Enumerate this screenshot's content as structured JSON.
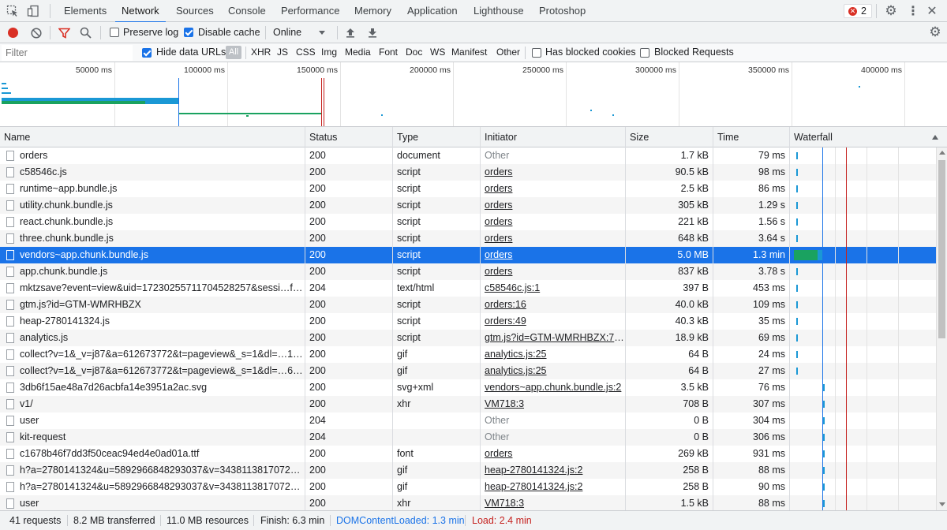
{
  "tabs": [
    "Elements",
    "Network",
    "Sources",
    "Console",
    "Performance",
    "Memory",
    "Application",
    "Lighthouse",
    "Protoshop"
  ],
  "error_count": "2",
  "toolbar": {
    "preserve_log": "Preserve log",
    "preserve_log_checked": false,
    "disable_cache": "Disable cache",
    "disable_cache_checked": true,
    "throttling": "Online"
  },
  "filterbar": {
    "placeholder": "Filter",
    "hide_data_urls": "Hide data URLs",
    "all": "All",
    "types": [
      "XHR",
      "JS",
      "CSS",
      "Img",
      "Media",
      "Font",
      "Doc",
      "WS",
      "Manifest",
      "Other"
    ],
    "has_blocked_cookies": "Has blocked cookies",
    "blocked_requests": "Blocked Requests"
  },
  "overview": {
    "ticks": [
      "50000 ms",
      "100000 ms",
      "150000 ms",
      "200000 ms",
      "250000 ms",
      "300000 ms",
      "350000 ms",
      "400000 ms"
    ]
  },
  "columns": [
    "Name",
    "Status",
    "Type",
    "Initiator",
    "Size",
    "Time",
    "Waterfall"
  ],
  "rows": [
    {
      "name": "orders",
      "status": "200",
      "type": "document",
      "initiator": "Other",
      "initiator_link": false,
      "size": "1.7 kB",
      "time": "79 ms",
      "wf": 0.02
    },
    {
      "name": "c58546c.js",
      "status": "200",
      "type": "script",
      "initiator": "orders",
      "initiator_link": true,
      "size": "90.5 kB",
      "time": "98 ms",
      "wf": 0.02
    },
    {
      "name": "runtime~app.bundle.js",
      "status": "200",
      "type": "script",
      "initiator": "orders",
      "initiator_link": true,
      "size": "2.5 kB",
      "time": "86 ms",
      "wf": 0.02
    },
    {
      "name": "utility.chunk.bundle.js",
      "status": "200",
      "type": "script",
      "initiator": "orders",
      "initiator_link": true,
      "size": "305 kB",
      "time": "1.29 s",
      "wf": 0.02
    },
    {
      "name": "react.chunk.bundle.js",
      "status": "200",
      "type": "script",
      "initiator": "orders",
      "initiator_link": true,
      "size": "221 kB",
      "time": "1.56 s",
      "wf": 0.02
    },
    {
      "name": "three.chunk.bundle.js",
      "status": "200",
      "type": "script",
      "initiator": "orders",
      "initiator_link": true,
      "size": "648 kB",
      "time": "3.64 s",
      "wf": 0.02
    },
    {
      "name": "vendors~app.chunk.bundle.js",
      "status": "200",
      "type": "script",
      "initiator": "orders",
      "initiator_link": true,
      "size": "5.0 MB",
      "time": "1.3 min",
      "selected": true,
      "wf": 0.2
    },
    {
      "name": "app.chunk.bundle.js",
      "status": "200",
      "type": "script",
      "initiator": "orders",
      "initiator_link": true,
      "size": "837 kB",
      "time": "3.78 s",
      "wf": 0.02
    },
    {
      "name": "mktzsave?event=view&uid=17230255711704528257&sessi…ferer…",
      "status": "204",
      "type": "text/html",
      "initiator": "c58546c.js:1",
      "initiator_link": true,
      "size": "397 B",
      "time": "453 ms",
      "wf": 0.02
    },
    {
      "name": "gtm.js?id=GTM-WMRHBZX",
      "status": "200",
      "type": "script",
      "initiator": "orders:16",
      "initiator_link": true,
      "size": "40.0 kB",
      "time": "109 ms",
      "wf": 0.02
    },
    {
      "name": "heap-2780141324.js",
      "status": "200",
      "type": "script",
      "initiator": "orders:49",
      "initiator_link": true,
      "size": "40.3 kB",
      "time": "35 ms",
      "wf": 0.02
    },
    {
      "name": "analytics.js",
      "status": "200",
      "type": "script",
      "initiator": "gtm.js?id=GTM-WMRHBZX:703",
      "initiator_link": true,
      "size": "18.9 kB",
      "time": "69 ms",
      "wf": 0.02
    },
    {
      "name": "collect?v=1&_v=j87&a=612673772&t=pageview&_s=1&dl=…16118…",
      "status": "200",
      "type": "gif",
      "initiator": "analytics.js:25",
      "initiator_link": true,
      "size": "64 B",
      "time": "24 ms",
      "wf": 0.02
    },
    {
      "name": "collect?v=1&_v=j87&a=612673772&t=pageview&_s=1&dl=…61186…",
      "status": "200",
      "type": "gif",
      "initiator": "analytics.js:25",
      "initiator_link": true,
      "size": "64 B",
      "time": "27 ms",
      "wf": 0.02
    },
    {
      "name": "3db6f15ae48a7d26acbfa14e3951a2ac.svg",
      "status": "200",
      "type": "svg+xml",
      "initiator": "vendors~app.chunk.bundle.js:2",
      "initiator_link": true,
      "size": "3.5 kB",
      "time": "76 ms",
      "wf": 0.21
    },
    {
      "name": "v1/",
      "status": "200",
      "type": "xhr",
      "initiator": "VM718:3",
      "initiator_link": true,
      "size": "708 B",
      "time": "307 ms",
      "wf": 0.21
    },
    {
      "name": "user",
      "status": "204",
      "type": "",
      "initiator": "Other",
      "initiator_link": false,
      "size": "0 B",
      "time": "304 ms",
      "wf": 0.21
    },
    {
      "name": "kit-request",
      "status": "204",
      "type": "",
      "initiator": "Other",
      "initiator_link": false,
      "size": "0 B",
      "time": "306 ms",
      "wf": 0.21
    },
    {
      "name": "c1678b46f7dd3f50ceac94ed4e0ad01a.ttf",
      "status": "200",
      "type": "font",
      "initiator": "orders",
      "initiator_link": true,
      "size": "269 kB",
      "time": "931 ms",
      "wf": 0.21
    },
    {
      "name": "h?a=2780141324&u=5892966848293037&v=34381138170729.…",
      "status": "200",
      "type": "gif",
      "initiator": "heap-2780141324.js:2",
      "initiator_link": true,
      "size": "258 B",
      "time": "88 ms",
      "wf": 0.21
    },
    {
      "name": "h?a=2780141324&u=5892966848293037&v=34381138170729.…",
      "status": "200",
      "type": "gif",
      "initiator": "heap-2780141324.js:2",
      "initiator_link": true,
      "size": "258 B",
      "time": "90 ms",
      "wf": 0.21
    },
    {
      "name": "user",
      "status": "200",
      "type": "xhr",
      "initiator": "VM718:3",
      "initiator_link": true,
      "size": "1.5 kB",
      "time": "88 ms",
      "wf": 0.21
    }
  ],
  "statusbar": {
    "requests": "41 requests",
    "transferred": "8.2 MB transferred",
    "resources": "11.0 MB resources",
    "finish": "Finish: 6.3 min",
    "dcl": "DOMContentLoaded: 1.3 min",
    "load": "Load: 2.4 min"
  },
  "colors": {
    "accent": "#1a73e8",
    "dcl": "#1a73e8",
    "load": "#c5221f",
    "waterfall": "#1a98d5",
    "selected_wf": "#1aa260"
  }
}
